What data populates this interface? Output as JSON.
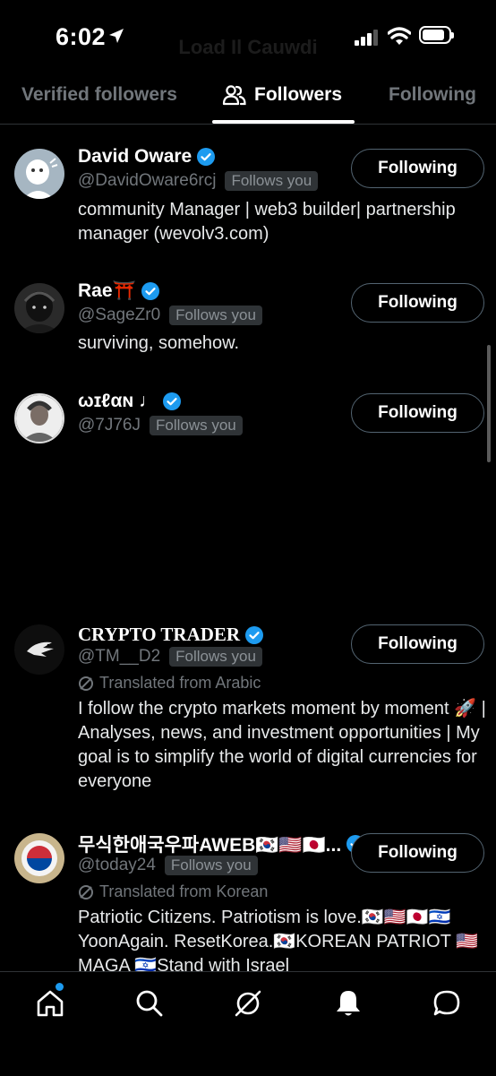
{
  "status": {
    "time": "6:02",
    "header_title": "Load Il Cauwdi"
  },
  "tabs": [
    {
      "label": "Verified followers"
    },
    {
      "label": "Followers"
    },
    {
      "label": "Following"
    }
  ],
  "users": [
    {
      "name": "David Oware",
      "handle": "@DavidOware6rcj",
      "follows_you": "Follows you",
      "bio": "community Manager | web3 builder| partnership manager (wevolv3.com)",
      "button": "Following"
    },
    {
      "name": "Rae⛩️",
      "handle": "@SageZr0",
      "follows_you": "Follows you",
      "bio": "surviving, somehow.",
      "button": "Following"
    },
    {
      "name": "ωɪℓαɴ ♩",
      "handle": "@7J76J",
      "follows_you": "Follows you",
      "button": "Following"
    },
    {
      "name": "CRYPTO TRADER",
      "handle": "@TM__D2",
      "follows_you": "Follows you",
      "translated": "Translated from Arabic",
      "bio": "I follow the crypto markets moment by moment 🚀 | Analyses, news, and investment opportunities | My goal is to simplify the world of digital currencies for everyone",
      "button": "Following"
    },
    {
      "name": "무식한애국우파AWEB🇰🇷🇺🇸🇯🇵...",
      "handle": "@today24",
      "follows_you": "Follows you",
      "translated": "Translated from Korean",
      "bio": "Patriotic Citizens. Patriotism is love.🇰🇷🇺🇸🇯🇵🇮🇱 YoonAgain. ResetKorea.🇰🇷KOREAN PATRIOT 🇺🇸 MAGA 🇮🇱Stand with Israel",
      "button": "Following"
    }
  ],
  "colors": {
    "accent": "#1d9bf0",
    "muted": "#71767b",
    "border": "#2f3336"
  },
  "nav": [
    {
      "icon": "home-icon"
    },
    {
      "icon": "search-icon"
    },
    {
      "icon": "grok-icon"
    },
    {
      "icon": "notifications-icon"
    },
    {
      "icon": "messages-icon"
    }
  ]
}
